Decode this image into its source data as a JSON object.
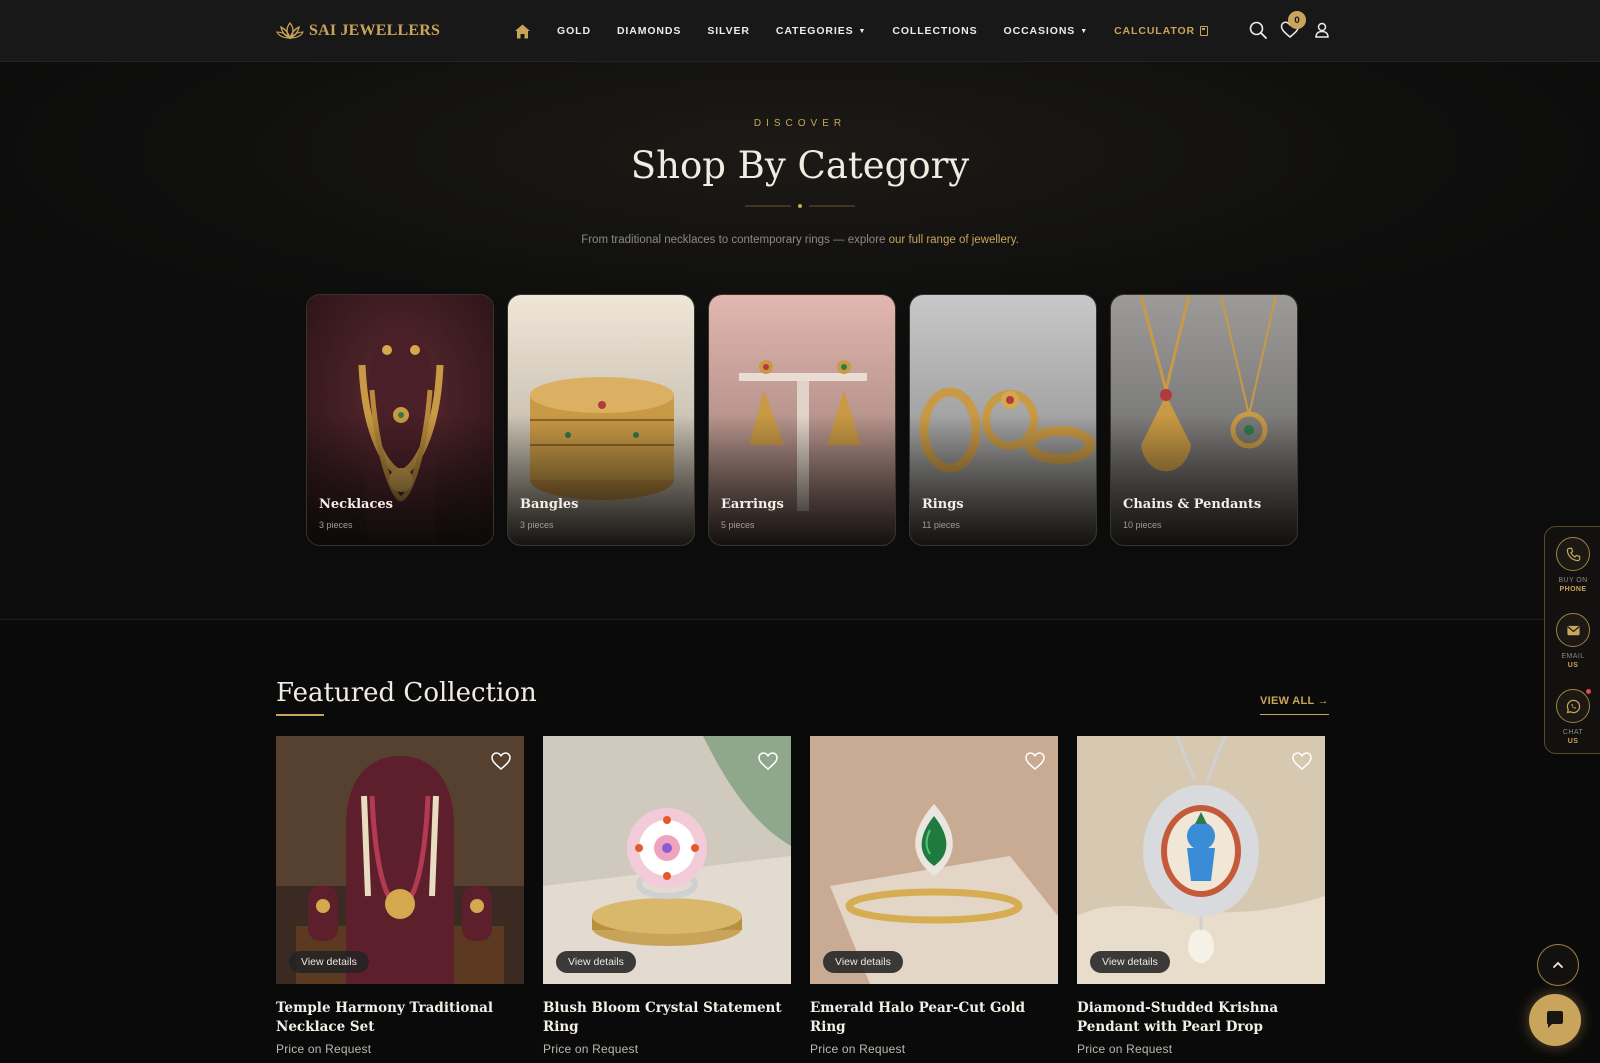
{
  "header": {
    "brand": "SAI JEWELLERS",
    "nav": [
      {
        "label": "GOLD"
      },
      {
        "label": "DIAMONDS"
      },
      {
        "label": "SILVER"
      },
      {
        "label": "CATEGORIES",
        "dropdown": true
      },
      {
        "label": "COLLECTIONS"
      },
      {
        "label": "OCCASIONS",
        "dropdown": true
      },
      {
        "label": "CALCULATOR",
        "accent": true
      }
    ],
    "wishlist_count": "0"
  },
  "category_section": {
    "eyebrow": "DISCOVER",
    "title": "Shop By Category",
    "subtitle_prefix": "From traditional necklaces to contemporary rings — explore ",
    "subtitle_link": "our full range of jewellery.",
    "categories": [
      {
        "name": "Necklaces",
        "count": "3 pieces"
      },
      {
        "name": "Bangles",
        "count": "3 pieces"
      },
      {
        "name": "Earrings",
        "count": "5 pieces"
      },
      {
        "name": "Rings",
        "count": "11 pieces"
      },
      {
        "name": "Chains & Pendants",
        "count": "10 pieces"
      }
    ]
  },
  "featured": {
    "title": "Featured Collection",
    "view_all": "VIEW ALL",
    "view_details_label": "View details",
    "products": [
      {
        "name": "Temple Harmony Traditional Necklace Set",
        "price": "Price on Request"
      },
      {
        "name": "Blush Bloom Crystal Statement Ring",
        "price": "Price on Request"
      },
      {
        "name": "Emerald Halo Pear-Cut Gold Ring",
        "price": "Price on Request"
      },
      {
        "name": "Diamond-Studded Krishna Pendant with Pearl Drop",
        "price": "Price on Request"
      }
    ]
  },
  "side_bar": [
    {
      "top": "BUY ON",
      "bottom": "PHONE"
    },
    {
      "top": "EMAIL",
      "bottom": "US"
    },
    {
      "top": "CHAT",
      "bottom": "US"
    }
  ],
  "colors": {
    "accent_gold": "#c9a55b",
    "background": "#0a0a0a",
    "header": "#181818"
  }
}
